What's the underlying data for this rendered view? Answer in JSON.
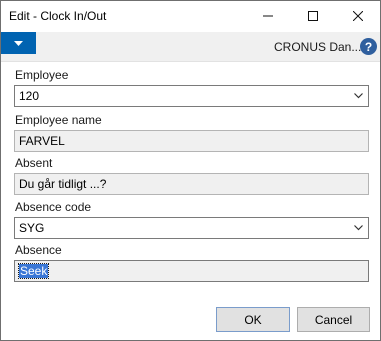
{
  "window": {
    "title": "Edit - Clock In/Out"
  },
  "actionbar": {
    "company": "CRONUS Dan...",
    "help_glyph": "?",
    "menu_icon": "chevron-down-icon"
  },
  "form": {
    "employee": {
      "label": "Employee",
      "value": "120"
    },
    "employee_name": {
      "label": "Employee name",
      "value": "FARVEL"
    },
    "absent": {
      "label": "Absent",
      "value": "Du går tidligt ...?"
    },
    "absence_code": {
      "label": "Absence code",
      "value": "SYG"
    },
    "absence": {
      "label": "Absence",
      "value": "Seek"
    }
  },
  "buttons": {
    "ok": "OK",
    "cancel": "Cancel"
  },
  "colors": {
    "accent": "#0063b1",
    "selection": "#3a77d6",
    "help": "#2f5f9e"
  }
}
